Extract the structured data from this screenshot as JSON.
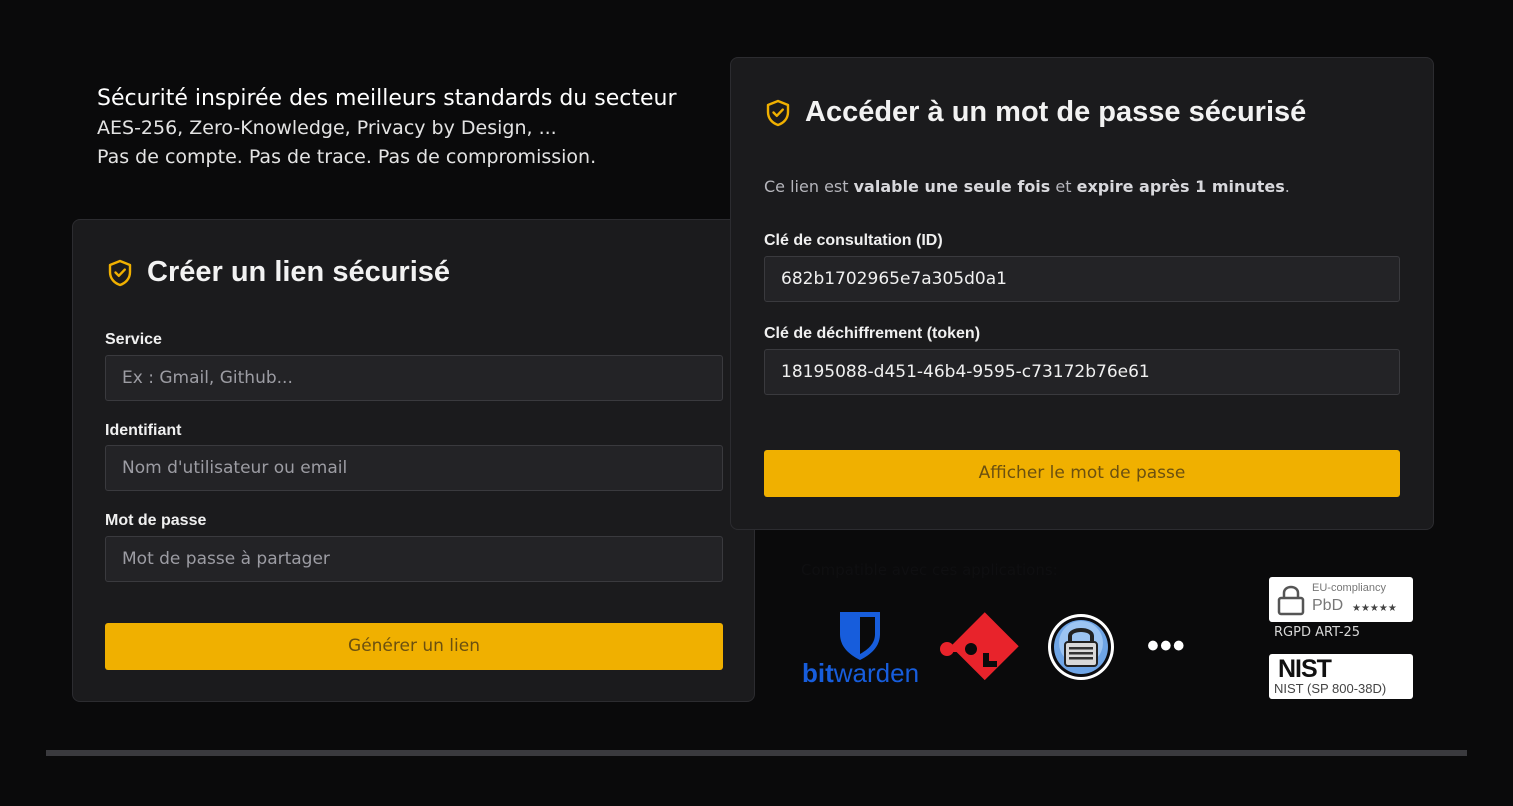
{
  "intro": {
    "headline": "Sécurité inspirée des meilleurs standards du secteur",
    "line1": "AES-256, Zero-Knowledge, Privacy by Design, ...",
    "line2": "Pas de compte. Pas de trace. Pas de compromission."
  },
  "create": {
    "title": "Créer un lien sécurisé",
    "service_label": "Service",
    "service_placeholder": "Ex : Gmail, Github...",
    "identifier_label": "Identifiant",
    "identifier_placeholder": "Nom d'utilisateur ou email",
    "password_label": "Mot de passe",
    "password_placeholder": "Mot de passe à partager",
    "submit_label": "Générer un lien"
  },
  "access": {
    "title": "Accéder à un mot de passe sécurisé",
    "notice_prefix": "Ce lien est ",
    "notice_bold1": "valable une seule fois",
    "notice_mid": " et ",
    "notice_bold2": "expire après 1 minutes",
    "notice_suffix": ".",
    "id_label": "Clé de consultation (ID)",
    "id_value": "682b1702965e7a305d0a1",
    "token_label": "Clé de déchiffrement (token)",
    "token_value": "18195088-d451-46b4-9595-c73172b76e61",
    "submit_label": "Afficher le mot de passe"
  },
  "compat": {
    "caption": "Compatible avec ces applications:",
    "apps": [
      {
        "name": "bitwarden",
        "icon": "bitwarden-icon",
        "bit": "bit",
        "warden": "warden"
      },
      {
        "name": "git-style",
        "icon": "git-key-icon"
      },
      {
        "name": "keepass",
        "icon": "keepass-lock-icon"
      }
    ],
    "more": "•••"
  },
  "badges": {
    "pbd_top": "EU-compliancy",
    "pbd_main": "PbD",
    "pbd_stars": "★★★★★",
    "pbd_caption": "RGPD ART-25",
    "nist_logo": "NIST",
    "nist_caption": "NIST (SP 800-38D)"
  },
  "colors": {
    "accent": "#f0b000",
    "background": "#0a0a0b",
    "card": "#1b1b1d",
    "bitwarden": "#175ddc",
    "git_red": "#e8232b"
  }
}
